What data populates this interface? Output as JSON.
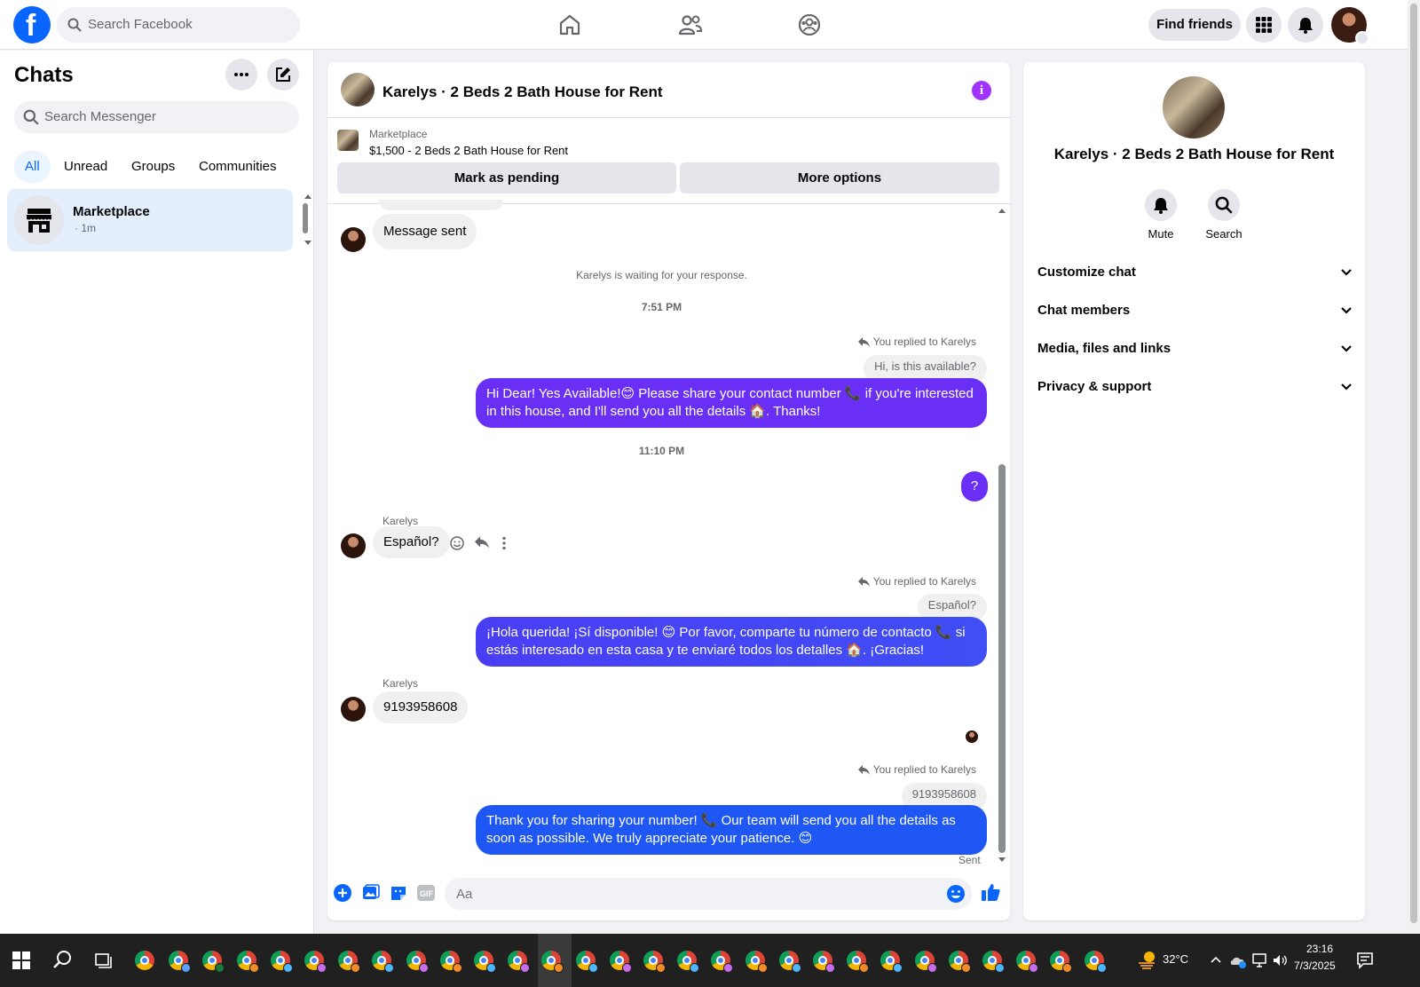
{
  "topbar": {
    "logo": "f",
    "search_placeholder": "Search Facebook",
    "find_friends": "Find friends",
    "icons": [
      "home-icon",
      "friends-icon",
      "groups-icon",
      "menu-grid-icon",
      "notifications-icon"
    ]
  },
  "left": {
    "title": "Chats",
    "search_placeholder": "Search Messenger",
    "filters": [
      "All",
      "Unread",
      "Groups",
      "Communities"
    ],
    "active_filter": "All",
    "chat": {
      "name": "Marketplace",
      "time": "· 1m"
    }
  },
  "conversation": {
    "title": "Karelys · 2 Beds 2 Bath House for Rent",
    "marketplace_label": "Marketplace",
    "listing": "$1,500 - 2 Beds 2 Bath House for Rent",
    "mark_pending": "Mark as pending",
    "more_options": "More options",
    "messages": {
      "m1": "Message sent",
      "waiting": "Karelys is waiting for your response.",
      "ts1": "7:51 PM",
      "replied1": "You replied to Karelys",
      "quote1": "Hi, is this available?",
      "out1": "Hi Dear! Yes Available!😊 Please share your contact number 📞 if you're interested in this house, and I'll send you all the details 🏠. Thanks!",
      "ts2": "11:10 PM",
      "q": "?",
      "sender2": "Karelys",
      "in2": "Español?",
      "replied2": "You replied to Karelys",
      "quote2": "Español?",
      "out2": "¡Hola querida! ¡Sí disponible! 😊 Por favor, comparte tu número de contacto 📞 si estás interesado en esta casa y te enviaré todos los detalles 🏠. ¡Gracias!",
      "sender3": "Karelys",
      "in3": "9193958608",
      "replied3": "You replied to Karelys",
      "quote3": "9193958608",
      "out3": "Thank you for sharing your number! 📞 Our team will send you all the details as soon as possible. We truly appreciate your patience. 😊",
      "sent": "Sent"
    },
    "composer_placeholder": "Aa",
    "colors": {
      "purple": "#6a2ff4",
      "blue": "#1f57f5",
      "violet": "#4a3ef5"
    }
  },
  "right": {
    "name": "Karelys · 2 Beds 2 Bath House for Rent",
    "mute": "Mute",
    "search": "Search",
    "sections": [
      "Customize chat",
      "Chat members",
      "Media, files and links",
      "Privacy & support"
    ]
  },
  "taskbar": {
    "temperature": "32°C",
    "time": "23:16",
    "date": "7/3/2025"
  }
}
